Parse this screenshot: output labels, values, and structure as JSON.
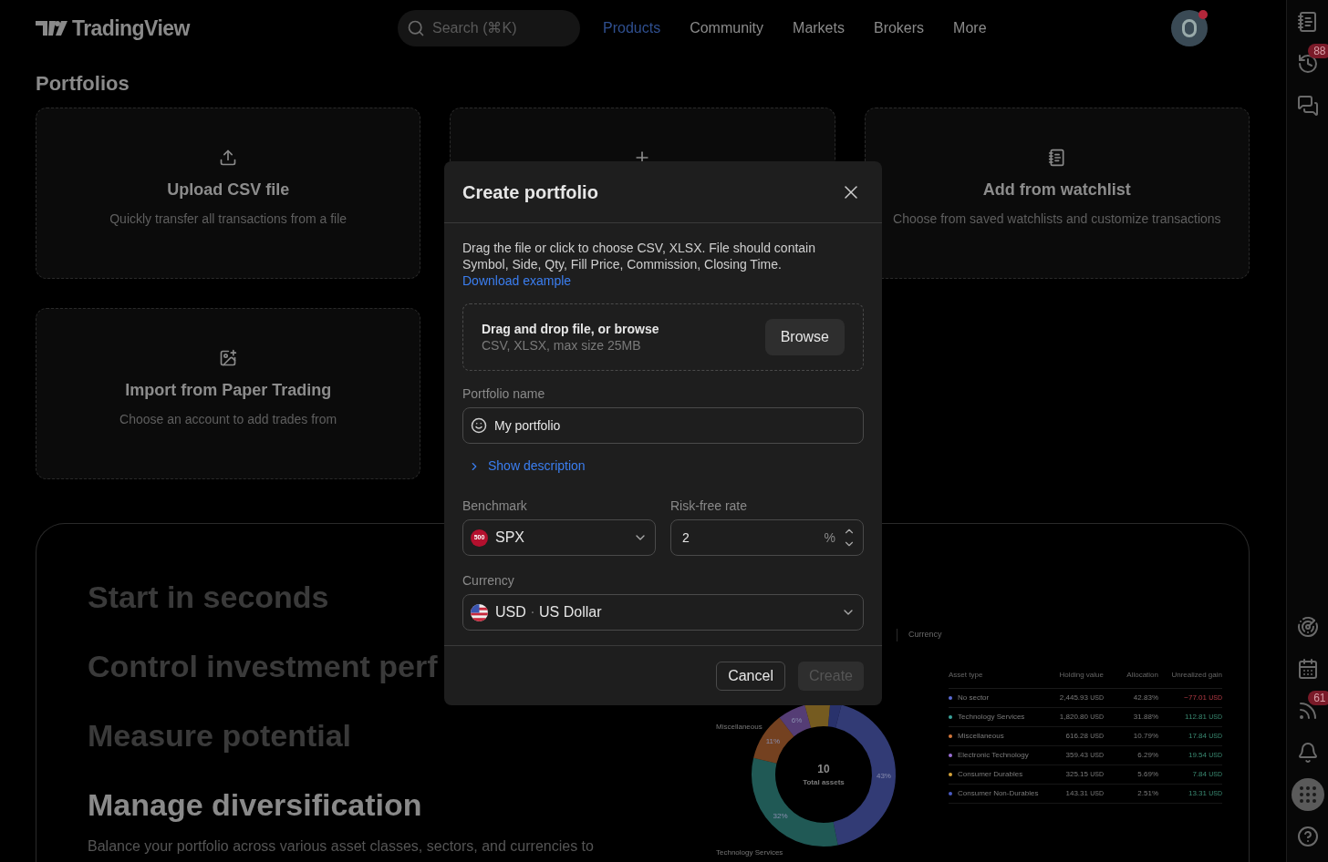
{
  "header": {
    "logo": "TradingView",
    "search": {
      "placeholder": "Search (⌘K)"
    },
    "nav": [
      {
        "label": "Products",
        "selected": true
      },
      {
        "label": "Community",
        "selected": false
      },
      {
        "label": "Markets",
        "selected": false
      },
      {
        "label": "Brokers",
        "selected": false
      },
      {
        "label": "More",
        "selected": false
      }
    ],
    "avatar": {
      "notification": true
    }
  },
  "page_title": "Portfolios",
  "cards": [
    {
      "kind": "upload",
      "title": "Upload CSV file",
      "subtitle": "Quickly transfer all transactions from a file"
    },
    {
      "kind": "plus"
    },
    {
      "kind": "watchlist",
      "title": "Add from watchlist",
      "subtitle": "Choose from saved watchlists and customize transactions"
    },
    {
      "kind": "paper",
      "title": "Import from Paper Trading",
      "subtitle": "Choose an account to add trades from"
    }
  ],
  "features": {
    "items": [
      {
        "label": "Start in seconds",
        "selected": false
      },
      {
        "label": "Control investment perf",
        "selected": false
      },
      {
        "label": "Measure potential",
        "selected": false
      },
      {
        "label": "Manage diversification",
        "selected": true
      }
    ],
    "description": "Balance your portfolio across various asset classes, sectors, and currencies to",
    "preview": {
      "tab": "Currency",
      "slice_labels": [
        "43%",
        "32%",
        "11%",
        "6%"
      ],
      "outer_labels": [
        "Miscellaneous",
        "Technology Services"
      ],
      "center_value": "10",
      "center_label": "Total assets",
      "table": {
        "columns": [
          "Asset type",
          "Holding value",
          "Allocation",
          "Unrealized gain"
        ],
        "rows": [
          {
            "color": "#5b6bd6",
            "name": "No sector",
            "value": "2,445.93",
            "unit": "USD",
            "allocation": "42.83%",
            "gain": "−77.01",
            "gain_unit": "USD",
            "negative": true
          },
          {
            "color": "#3aa39a",
            "name": "Technology Services",
            "value": "1,820.80",
            "unit": "USD",
            "allocation": "31.88%",
            "gain": "112.81",
            "gain_unit": "USD",
            "negative": false
          },
          {
            "color": "#d4773a",
            "name": "Miscellaneous",
            "value": "616.28",
            "unit": "USD",
            "allocation": "10.79%",
            "gain": "17.84",
            "gain_unit": "USD",
            "negative": false
          },
          {
            "color": "#9b6fd6",
            "name": "Electronic Technology",
            "value": "359.43",
            "unit": "USD",
            "allocation": "6.29%",
            "gain": "19.54",
            "gain_unit": "USD",
            "negative": false
          },
          {
            "color": "#d6a53a",
            "name": "Consumer Durables",
            "value": "325.15",
            "unit": "USD",
            "allocation": "5.69%",
            "gain": "7.84",
            "gain_unit": "USD",
            "negative": false
          },
          {
            "color": "#4a5bc4",
            "name": "Consumer Non-Durables",
            "value": "143.31",
            "unit": "USD",
            "allocation": "2.51%",
            "gain": "13.31",
            "gain_unit": "USD",
            "negative": false
          }
        ]
      }
    }
  },
  "dialog": {
    "title": "Create portfolio",
    "intro": "Drag the file or click to choose CSV, XLSX. File should contain Symbol, Side, Qty, Fill Price, Commission, Closing Time.",
    "intro_link": "Download example",
    "dropzone": {
      "title": "Drag and drop file, or browse",
      "hint": "CSV, XLSX, max size 25MB",
      "button": "Browse"
    },
    "name_label": "Portfolio name",
    "name_value": "My portfolio",
    "description_toggle": {
      "label": "Show description",
      "expanded": false
    },
    "benchmark": {
      "label": "Benchmark",
      "badge": "500",
      "value": "SPX"
    },
    "risk_free": {
      "label": "Risk-free rate",
      "value": "2",
      "unit": "%"
    },
    "currency": {
      "label": "Currency",
      "code": "USD",
      "separator": "·",
      "name": "US Dollar"
    },
    "buttons": [
      {
        "label": "Cancel",
        "disabled": false
      },
      {
        "label": "Create",
        "disabled": true
      }
    ]
  },
  "sidebar": {
    "top": [
      {
        "kind": "watchlist"
      },
      {
        "kind": "alerts",
        "badge": "88"
      },
      {
        "kind": "chat"
      }
    ],
    "bottom": [
      {
        "kind": "screener"
      },
      {
        "kind": "calendar"
      },
      {
        "kind": "news",
        "badge": "61"
      },
      {
        "kind": "notifications"
      },
      {
        "kind": "apps",
        "selected": true
      },
      {
        "kind": "help"
      }
    ]
  }
}
